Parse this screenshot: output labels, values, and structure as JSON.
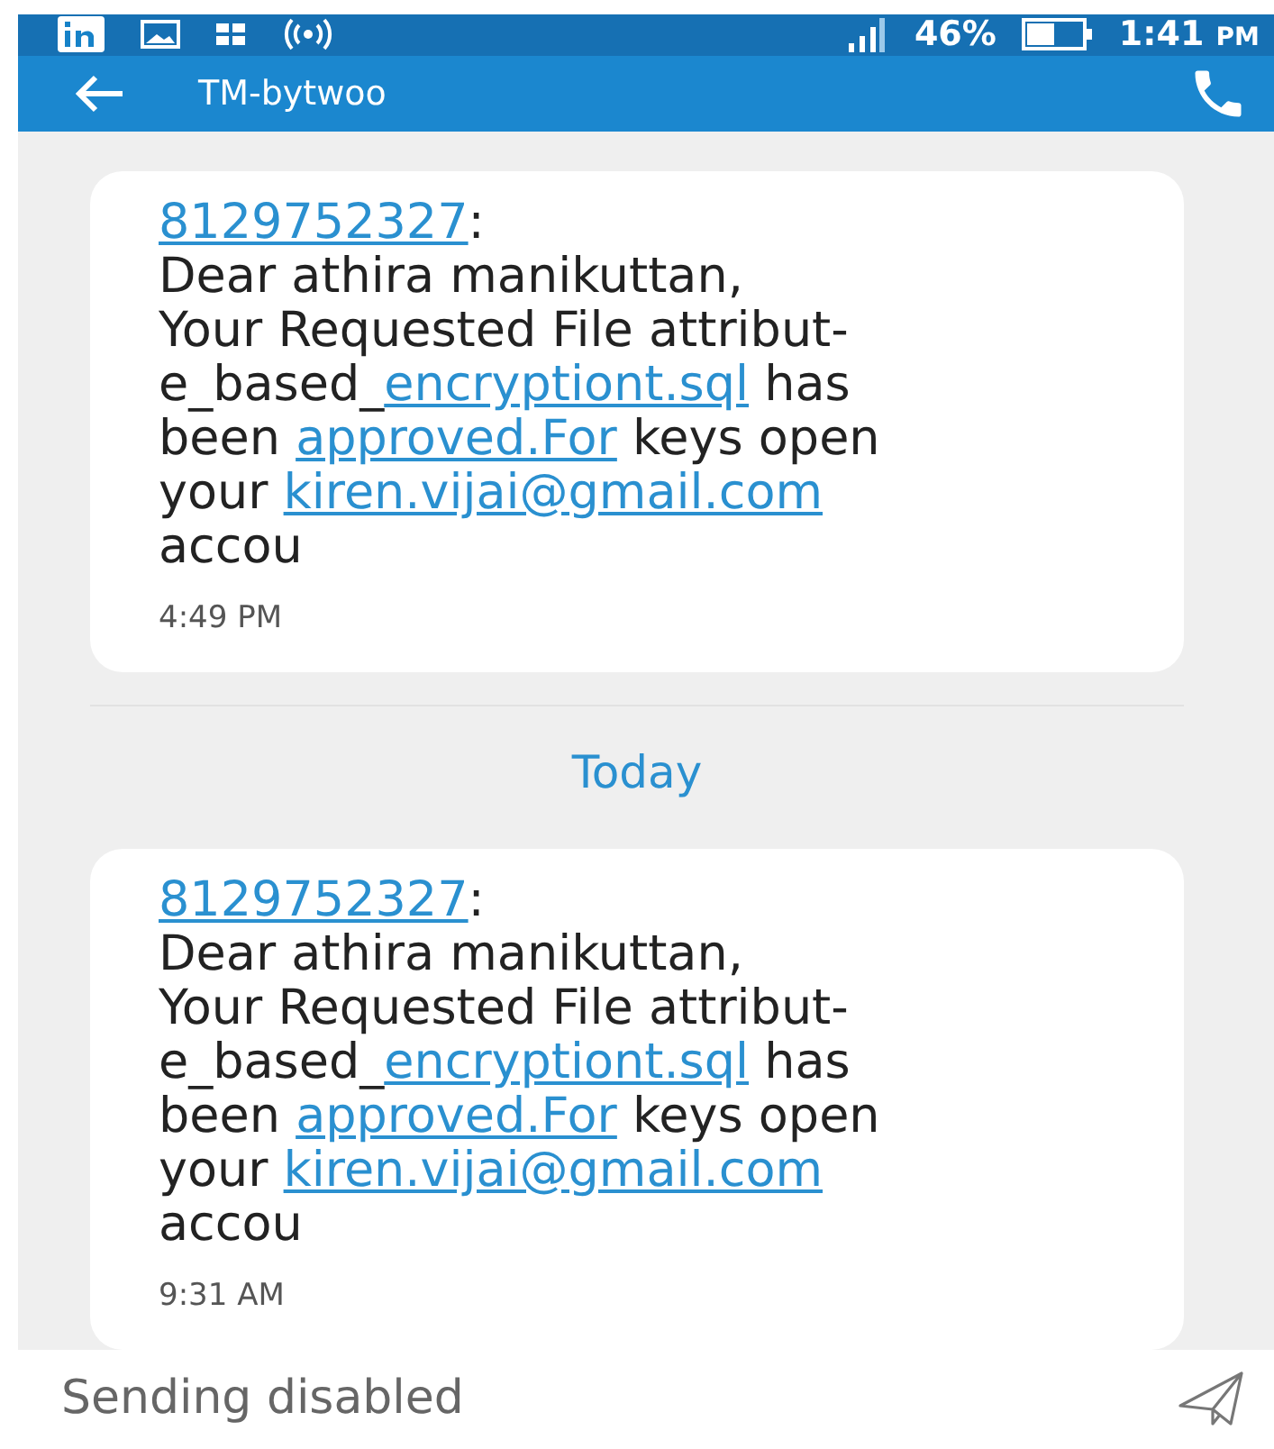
{
  "status_bar": {
    "battery": "46%",
    "time": "1:41",
    "time_suffix": "PM"
  },
  "app_bar": {
    "title": "TM-bytwoo"
  },
  "messages": [
    {
      "sender": "8129752327",
      "sender_suffix": ":",
      "lines": [
        [
          {
            "text": "Dear athira manikuttan,",
            "link": false
          }
        ],
        [
          {
            "text": "Your Requested File attribut-",
            "link": false
          }
        ],
        [
          {
            "text": "e_based_",
            "link": false
          },
          {
            "text": "encryptiont.sql",
            "link": true
          },
          {
            "text": " has",
            "link": false
          }
        ],
        [
          {
            "text": "been ",
            "link": false
          },
          {
            "text": "approved.For",
            "link": true
          },
          {
            "text": " keys open",
            "link": false
          }
        ],
        [
          {
            "text": "your ",
            "link": false
          },
          {
            "text": "kiren.vijai@gmail.com",
            "link": true
          }
        ],
        [
          {
            "text": "accou",
            "link": false
          }
        ]
      ],
      "time": "4:49 PM"
    },
    {
      "kind": "divider",
      "label": "Today"
    },
    {
      "sender": "8129752327",
      "sender_suffix": ":",
      "lines": [
        [
          {
            "text": "Dear athira manikuttan,",
            "link": false
          }
        ],
        [
          {
            "text": "Your Requested File attribut-",
            "link": false
          }
        ],
        [
          {
            "text": "e_based_",
            "link": false
          },
          {
            "text": "encryptiont.sql",
            "link": true
          },
          {
            "text": " has",
            "link": false
          }
        ],
        [
          {
            "text": "been ",
            "link": false
          },
          {
            "text": "approved.For",
            "link": true
          },
          {
            "text": " keys open",
            "link": false
          }
        ],
        [
          {
            "text": "your ",
            "link": false
          },
          {
            "text": "kiren.vijai@gmail.com",
            "link": true
          }
        ],
        [
          {
            "text": "accou",
            "link": false
          }
        ]
      ],
      "time": "9:31 AM"
    }
  ],
  "composer": {
    "placeholder": "Sending disabled"
  }
}
